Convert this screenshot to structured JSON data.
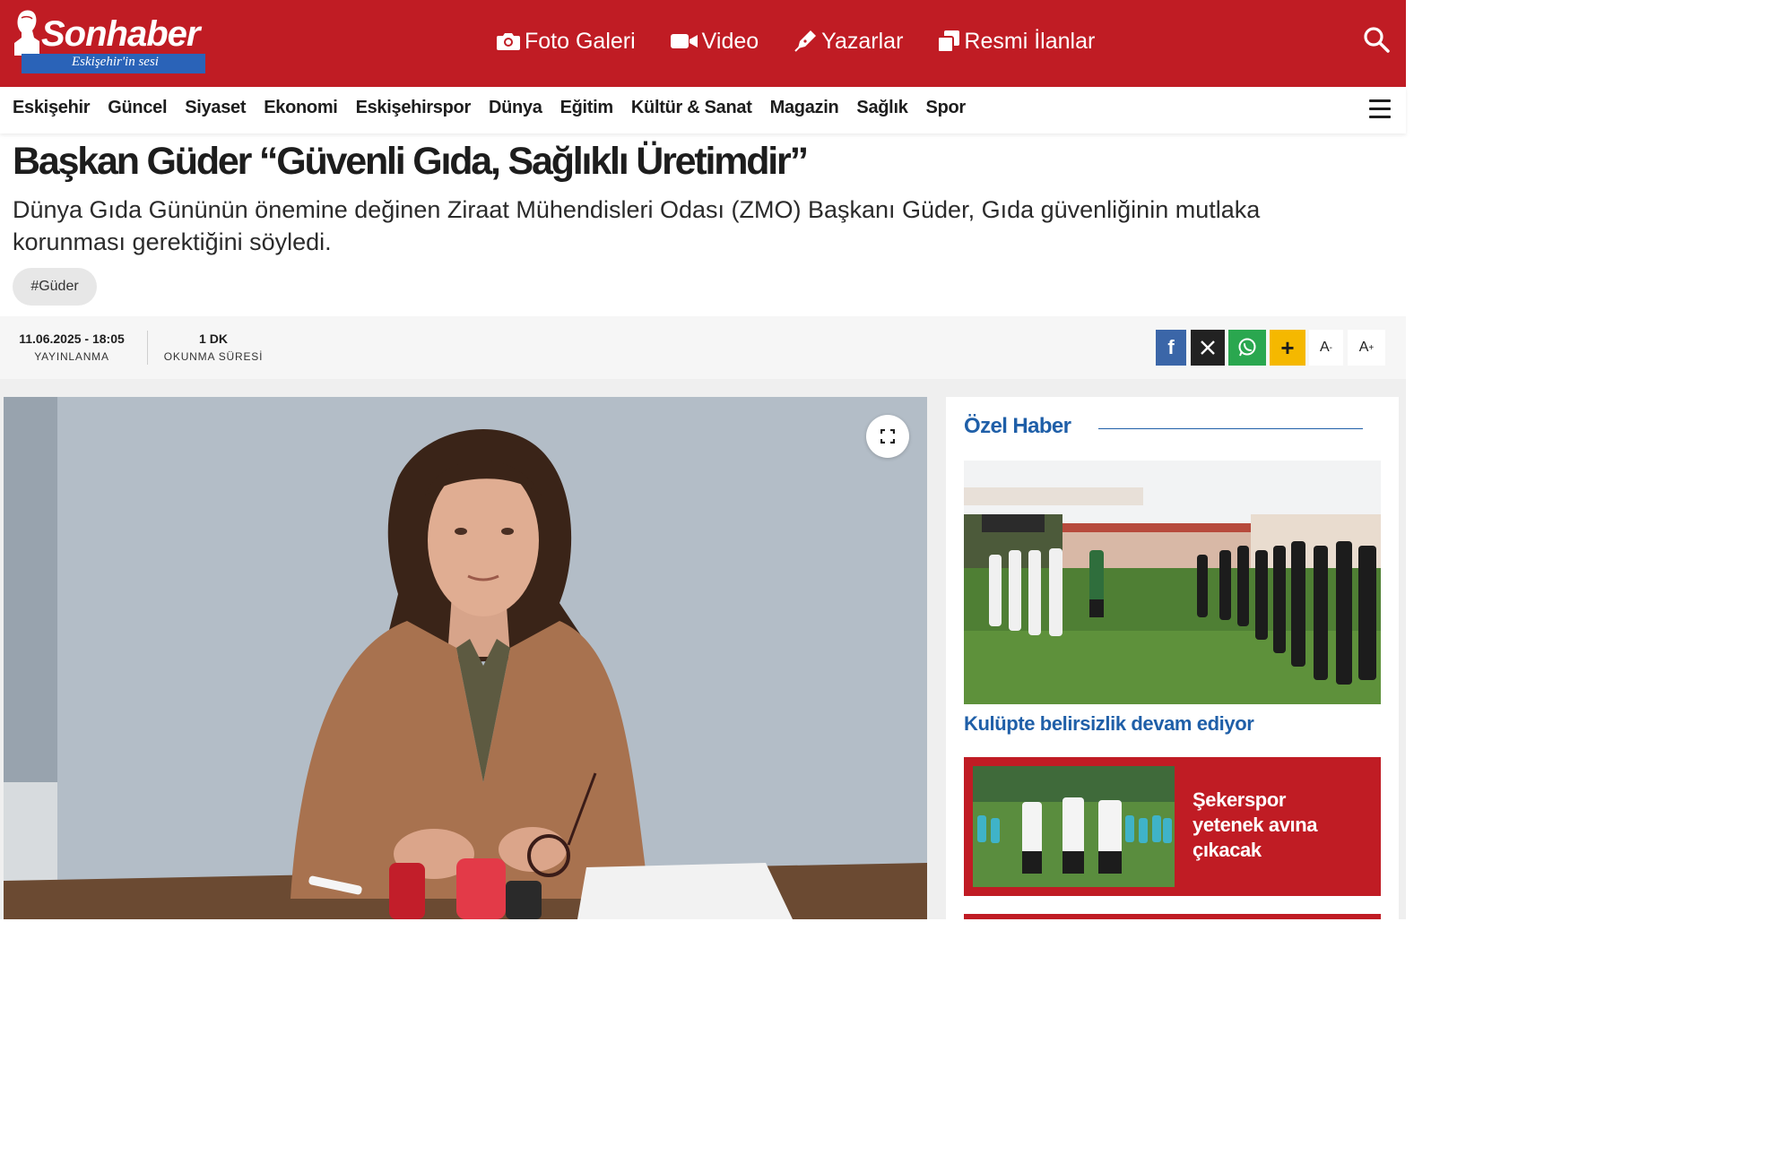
{
  "brand": {
    "logo_text": "Sonhaber",
    "tagline": "Eskişehir'in sesi"
  },
  "topnav": [
    {
      "label": "Foto Galeri",
      "icon": "camera-icon"
    },
    {
      "label": "Video",
      "icon": "video-camera-icon"
    },
    {
      "label": "Yazarlar",
      "icon": "pen-icon"
    },
    {
      "label": "Resmi İlanlar",
      "icon": "documents-icon"
    }
  ],
  "categories": [
    "Eskişehir",
    "Güncel",
    "Siyaset",
    "Ekonomi",
    "Eskişehirspor",
    "Dünya",
    "Eğitim",
    "Kültür & Sanat",
    "Magazin",
    "Sağlık",
    "Spor"
  ],
  "article": {
    "title": "Başkan Güder “Güvenli Gıda, Sağlıklı Üretimdir”",
    "summary": "Dünya Gıda Gününün önemine değinen Ziraat Mühendisleri Odası (ZMO) Başkanı Güder, Gıda güvenliğinin mutlaka korunması gerektiğini söyledi.",
    "tag": "#Güder",
    "published_value": "11.06.2025 - 18:05",
    "published_label": "YAYINLANMA",
    "read_value": "1 DK",
    "read_label": "OKUNMA SÜRESİ"
  },
  "share": {
    "facebook": "f",
    "more": "+",
    "font_decrease": "A",
    "font_decrease_sup": "-",
    "font_increase": "A",
    "font_increase_sup": "+"
  },
  "sidebar": {
    "title": "Özel Haber",
    "lead_headline": "Kulüpte belirsizlik devam ediyor",
    "card_headline": "Şekerspor yetenek avına çıkacak"
  },
  "colors": {
    "brand_red": "#c01c24",
    "accent_blue": "#1f5fa8",
    "facebook": "#3b66a8",
    "x": "#222222",
    "whatsapp": "#2aa74f",
    "more": "#f5b800"
  }
}
